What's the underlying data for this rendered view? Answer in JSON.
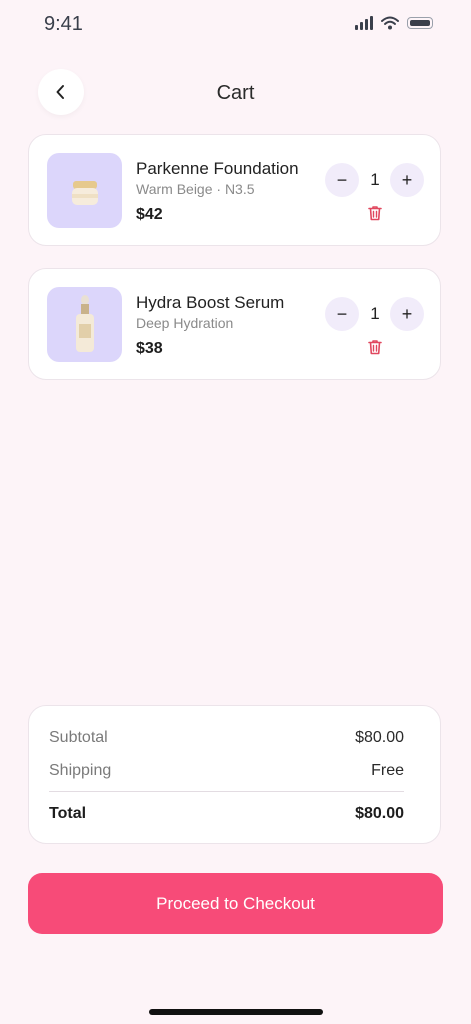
{
  "status": {
    "time": "9:41"
  },
  "header": {
    "title": "Cart",
    "back_icon": "chevron-left-icon"
  },
  "items": [
    {
      "name": "Parkenne Foundation",
      "variant": "Warm Beige · N3.5",
      "price": "$42",
      "quantity": "1",
      "image_icon": "cream-jar-icon"
    },
    {
      "name": "Hydra Boost Serum",
      "variant": "Deep Hydration",
      "price": "$38",
      "quantity": "1",
      "image_icon": "serum-bottle-icon"
    }
  ],
  "controls": {
    "minus": "−",
    "plus": "+"
  },
  "summary": {
    "subtotal_label": "Subtotal",
    "subtotal_value": "$80.00",
    "shipping_label": "Shipping",
    "shipping_value": "Free",
    "total_label": "Total",
    "total_value": "$80.00"
  },
  "checkout": {
    "label": "Proceed to Checkout"
  },
  "colors": {
    "accent": "#f74b78",
    "thumb_bg": "#dcd6fb",
    "page_bg": "#fdf4f8",
    "trash": "#e0485f"
  }
}
